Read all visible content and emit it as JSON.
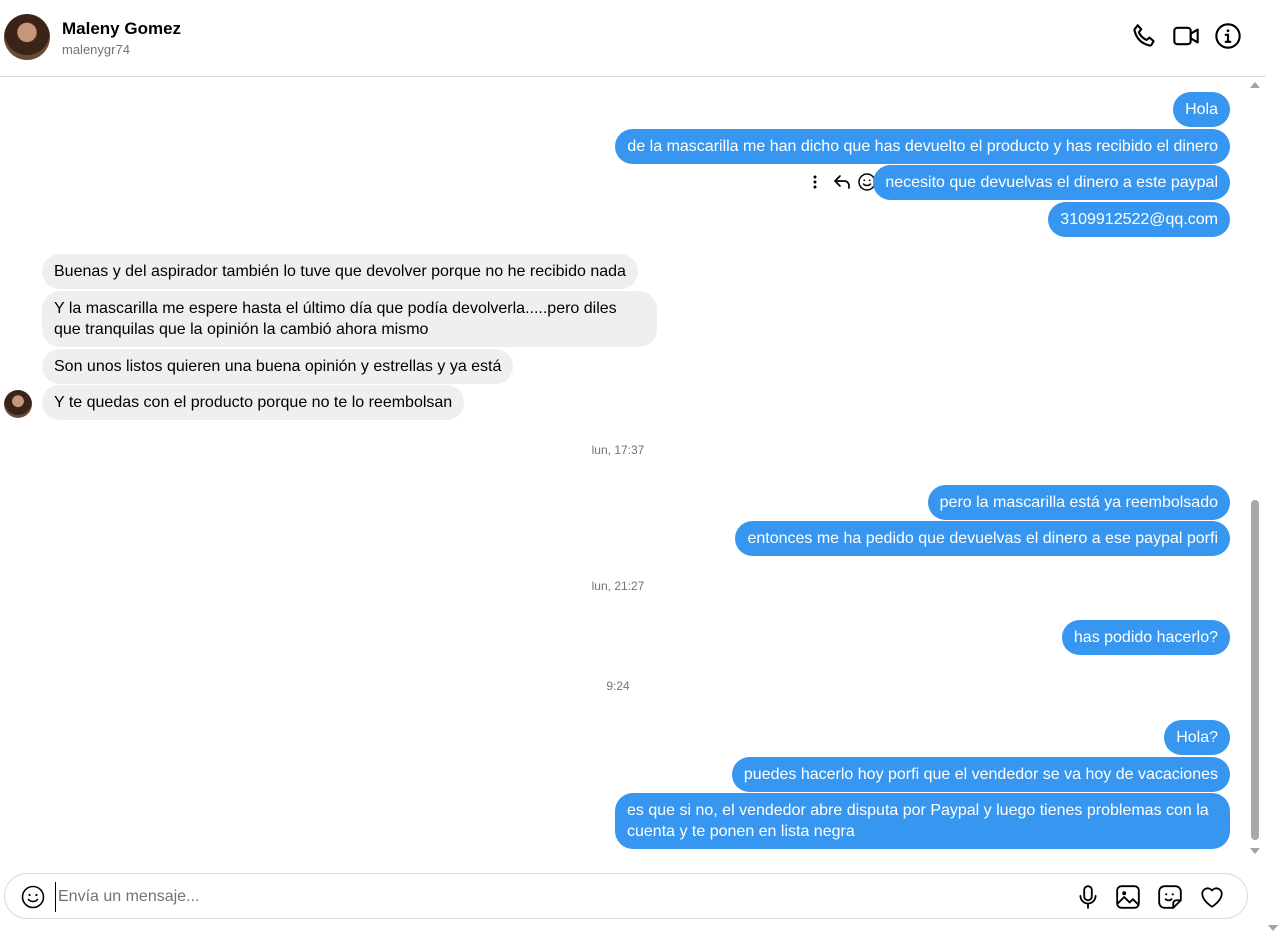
{
  "header": {
    "name": "Maleny Gomez",
    "handle": "malenygr74"
  },
  "messages": {
    "m1": "Hola",
    "m2": "de la mascarilla me han dicho que has devuelto el producto y has recibido el dinero",
    "m3": "necesito que devuelvas el dinero a este paypal",
    "m4": "3109912522@qq.com",
    "m5": "Buenas y del aspirador también lo tuve que devolver porque no he recibido nada",
    "m6": "Y la mascarilla me espere hasta el último día que podía devolverla.....pero diles que tranquilas que la opinión la cambió ahora mismo",
    "m7": "Son unos listos quieren una buena opinión y estrellas y ya está",
    "m8": "Y te quedas con el producto porque no te lo reembolsan",
    "m9": "pero la mascarilla está ya reembolsado",
    "m10": "entonces me ha pedido que devuelvas el dinero a ese paypal porfi",
    "m11": "has podido hacerlo?",
    "m12": "Hola?",
    "m13": "puedes hacerlo hoy porfi que el vendedor se va hoy de vacaciones",
    "m14": "es que si no, el vendedor abre disputa por Paypal y luego tienes problemas con la cuenta y te ponen en lista negra"
  },
  "timestamps": {
    "t1": "lun, 17:37",
    "t2": "lun, 21:27",
    "t3": "9:24"
  },
  "composer": {
    "placeholder": "Envía un mensaje..."
  },
  "icons": {
    "header": [
      "phone-icon",
      "video-icon",
      "info-icon"
    ],
    "hover": [
      "more-icon",
      "reply-icon",
      "react-icon"
    ],
    "composer": [
      "emoji-icon",
      "microphone-icon",
      "image-icon",
      "sticker-icon",
      "heart-icon"
    ]
  },
  "colors": {
    "outgoing_bubble": "#3797f0",
    "incoming_bubble": "#efefef"
  }
}
